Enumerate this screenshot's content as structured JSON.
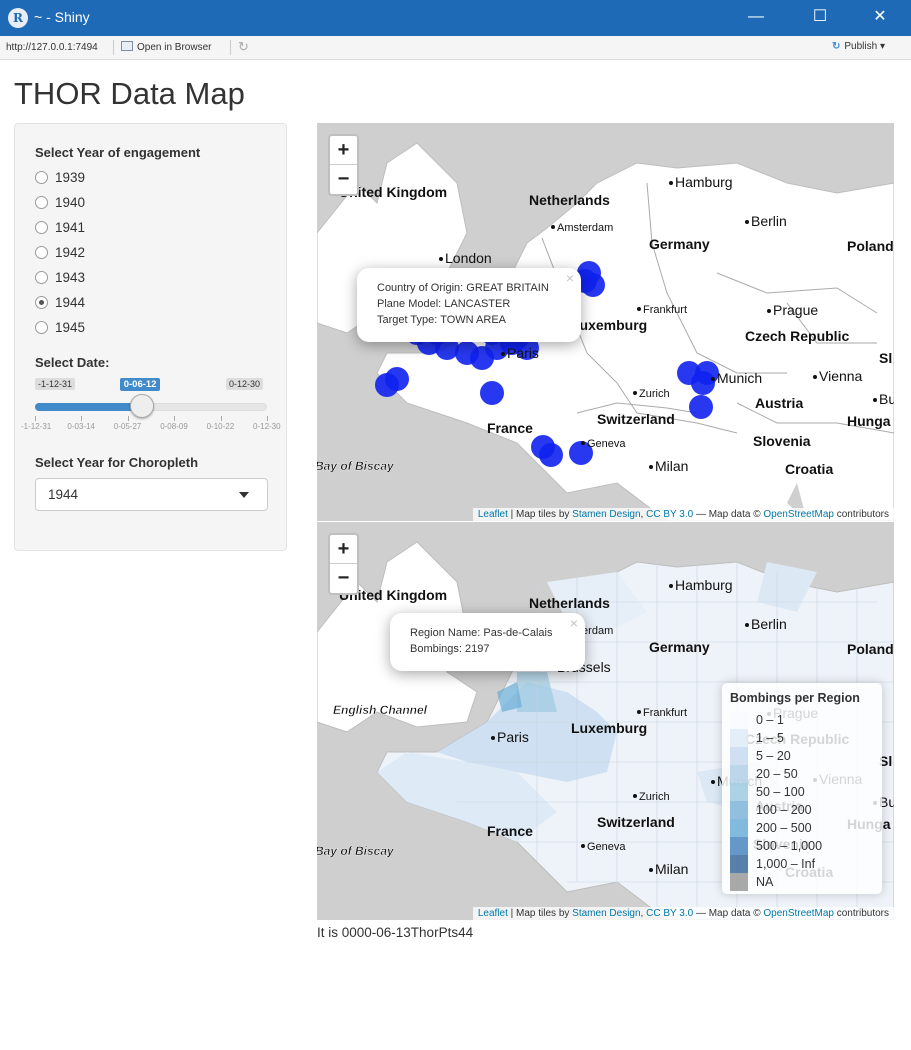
{
  "window": {
    "title": "~ - Shiny",
    "minimize_glyph": "—",
    "maximize_glyph": "☐",
    "close_glyph": "✕"
  },
  "toolbar": {
    "url": "http://127.0.0.1:7494",
    "open_in_browser": "Open in Browser",
    "publish": "Publish"
  },
  "page": {
    "title": "THOR Data Map"
  },
  "sidebar": {
    "year_label": "Select Year of engagement",
    "years": [
      "1939",
      "1940",
      "1941",
      "1942",
      "1943",
      "1944",
      "1945"
    ],
    "selected_year": "1944",
    "date_label": "Select Date:",
    "slider": {
      "min_label": "-1-12-31",
      "max_label": "0-12-30",
      "value_label": "0-06-12",
      "value_fraction": 0.46,
      "ticks": [
        "-1-12-31",
        "0-03-14",
        "0-05-27",
        "0-08-09",
        "0-10-22",
        "0-12-30"
      ]
    },
    "choropleth_label": "Select Year for Choropleth",
    "choropleth_value": "1944"
  },
  "map1": {
    "zoom_in": "+",
    "zoom_out": "−",
    "popup": {
      "line1": "Country of Origin: GREAT BRITAIN",
      "line2": "Plane Model: LANCASTER",
      "line3": "Target Type: TOWN AREA",
      "close": "×"
    },
    "attribution": {
      "leaflet": "Leaflet",
      "mid": " | Map tiles by ",
      "stamen": "Stamen Design",
      "comma": ", ",
      "cc": "CC BY 3.0",
      "data": " — Map data © ",
      "osm": "OpenStreetMap",
      "end": " contributors"
    },
    "marker_color": "#0f22ee"
  },
  "map2": {
    "zoom_in": "+",
    "zoom_out": "−",
    "popup": {
      "line1": "Region Name: Pas-de-Calais",
      "line2": "Bombings: 2197",
      "close": "×"
    },
    "legend": {
      "title": "Bombings per Region",
      "items": [
        {
          "label": "0 – 1",
          "color": "#f7fbff"
        },
        {
          "label": "1 – 5",
          "color": "#deebf7"
        },
        {
          "label": "5 – 20",
          "color": "#c6dbef"
        },
        {
          "label": "20 – 50",
          "color": "#b2d0e8"
        },
        {
          "label": "50 – 100",
          "color": "#9ecae1"
        },
        {
          "label": "100 – 200",
          "color": "#7fb4d9"
        },
        {
          "label": "200 – 500",
          "color": "#6baed6"
        },
        {
          "label": "500 – 1,000",
          "color": "#4a86bf"
        },
        {
          "label": "1,000 – Inf",
          "color": "#3a6a9c"
        },
        {
          "label": "NA",
          "color": "#9a9a9a"
        }
      ]
    }
  },
  "map_labels": {
    "united_kingdom": "United Kingdom",
    "netherlands": "Netherlands",
    "germany": "Germany",
    "poland": "Poland",
    "hamburg": "Hamburg",
    "berlin": "Berlin",
    "amsterdam": "Amsterdam",
    "london": "London",
    "frankfurt": "Frankfurt",
    "prague": "Prague",
    "czech_republic": "Czech Republic",
    "luxemburg": "Luxemburg",
    "paris": "Paris",
    "munich": "Munich",
    "vienna": "Vienna",
    "zurich": "Zurich",
    "switzerland": "Switzerland",
    "austria": "Austria",
    "france": "France",
    "geneva": "Geneva",
    "milan": "Milan",
    "slovenia": "Slovenia",
    "croatia": "Croatia",
    "hungary": "Hunga",
    "bay_of_biscay": "Bay of Biscay",
    "english_channel": "English Channel",
    "brussels": "Brussels",
    "bu": "Bu",
    "sl": "Sl"
  },
  "status_text": "It is 0000-06-13ThorPts44"
}
